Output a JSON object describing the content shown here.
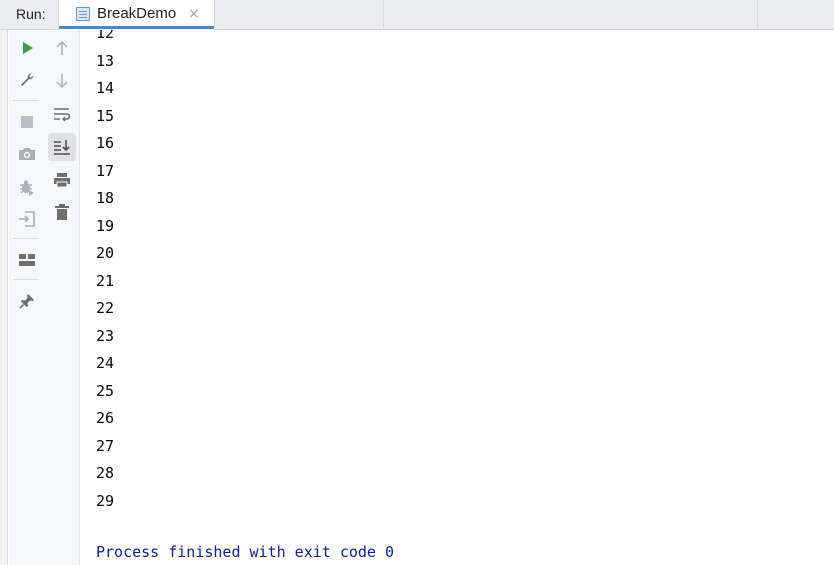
{
  "header": {
    "run_label": "Run:",
    "tab_title": "BreakDemo",
    "tab_close": "×"
  },
  "colors": {
    "run_green": "#3b9b4c",
    "icon_gray": "#6e6e6e",
    "icon_disabled": "#a9b0b8",
    "exit_text": "#0a1f96",
    "tab_accent": "#4a88c7"
  },
  "toolbar_left": [
    {
      "name": "rerun-icon",
      "enabled": true
    },
    {
      "name": "wrench-icon",
      "enabled": true
    },
    {
      "name": "stop-icon",
      "enabled": false
    },
    {
      "name": "camera-icon",
      "enabled": false
    },
    {
      "name": "debug-bug-icon",
      "enabled": false
    },
    {
      "name": "exit-icon",
      "enabled": false
    },
    {
      "name": "layout-icon",
      "enabled": true
    },
    {
      "name": "pin-icon",
      "enabled": true
    }
  ],
  "toolbar_right": [
    {
      "name": "up-arrow-icon",
      "enabled": false
    },
    {
      "name": "down-arrow-icon",
      "enabled": false
    },
    {
      "name": "soft-wrap-icon",
      "enabled": true
    },
    {
      "name": "scroll-to-end-icon",
      "enabled": true,
      "active": true
    },
    {
      "name": "print-icon",
      "enabled": true
    },
    {
      "name": "trash-icon",
      "enabled": true
    }
  ],
  "console": {
    "lines": [
      "12",
      "13",
      "14",
      "15",
      "16",
      "17",
      "18",
      "19",
      "20",
      "21",
      "22",
      "23",
      "24",
      "25",
      "26",
      "27",
      "28",
      "29",
      ""
    ],
    "exit_message": "Process finished with exit code 0"
  }
}
